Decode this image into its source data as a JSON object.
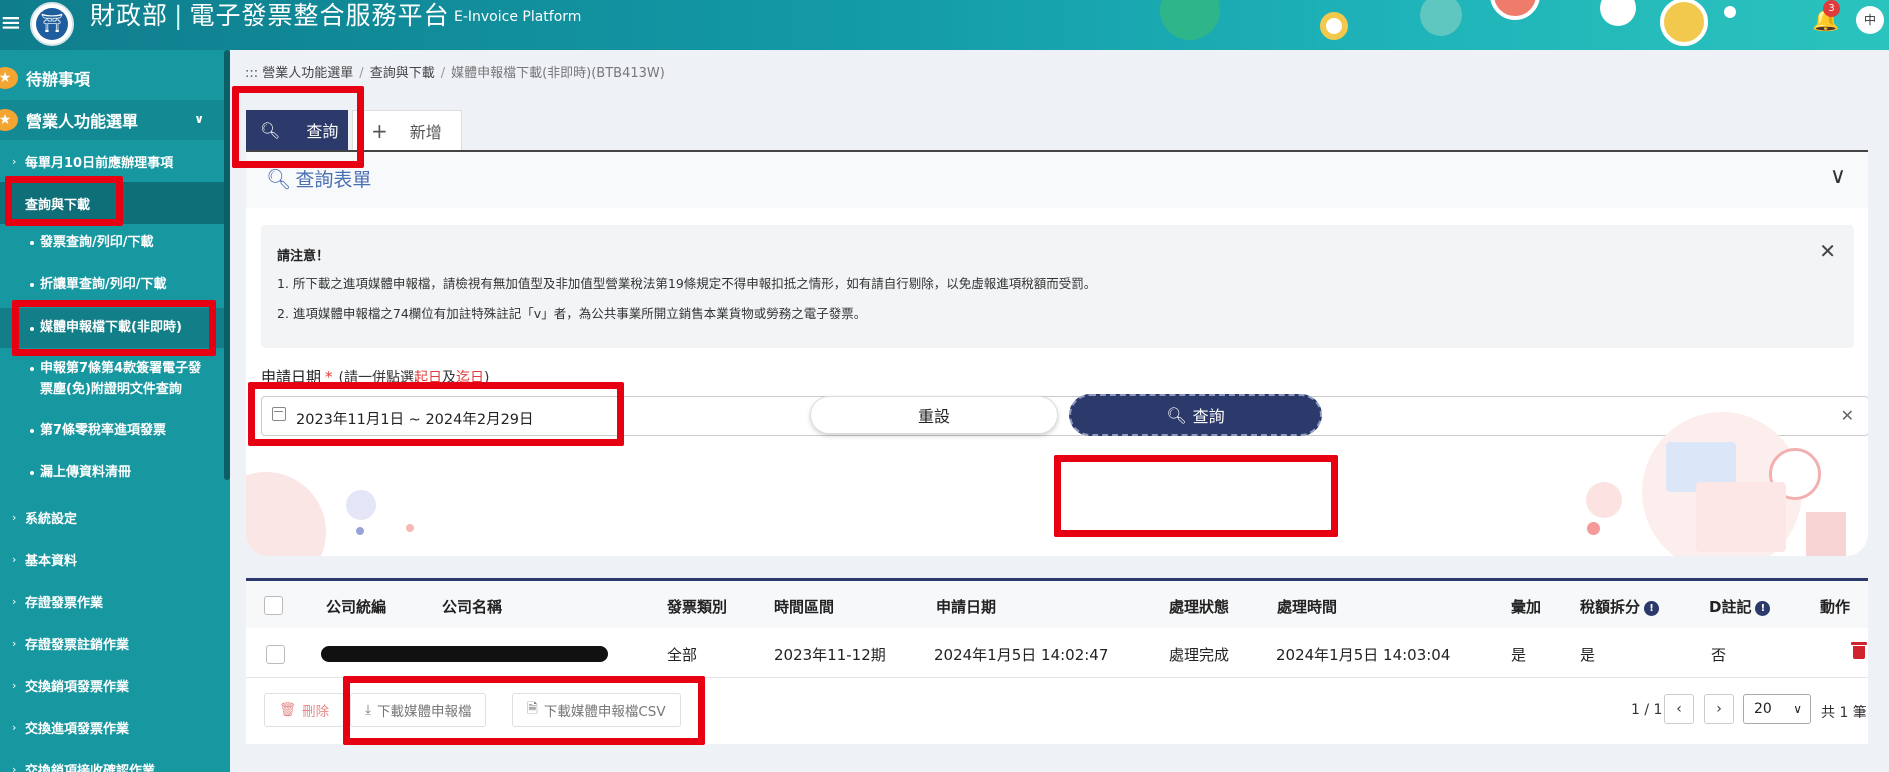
{
  "header": {
    "brand_ministry": "財政部",
    "brand_separator": "|",
    "brand_platform": "電子發票整合服務平台",
    "brand_en": "E-Invoice Platform",
    "logo_icon": "ministry-seal-icon",
    "notification_count": "3",
    "language": "中"
  },
  "sidebar": {
    "todo": "待辦事項",
    "business_menu": "營業人功能選單",
    "items": [
      {
        "label": "每單月10日前應辦理事項"
      },
      {
        "label": "查詢與下載"
      },
      {
        "label": "系統設定"
      },
      {
        "label": "基本資料"
      },
      {
        "label": "存證發票作業"
      },
      {
        "label": "存證發票註銷作業"
      },
      {
        "label": "交換銷項發票作業"
      },
      {
        "label": "交換進項發票作業"
      },
      {
        "label": "交換銷項接收確認作業"
      }
    ],
    "sub_items": [
      {
        "label": "發票查詢/列印/下載"
      },
      {
        "label": "折讓單查詢/列印/下載"
      },
      {
        "label": "媒體申報檔下載(非即時)"
      },
      {
        "label": "申報第7條第4款簽署電子發票塵(免)附證明文件查詢"
      },
      {
        "label": "第7條零稅率進項發票"
      },
      {
        "label": "漏上傳資料清冊"
      }
    ]
  },
  "breadcrumb": {
    "prefix": ":::",
    "items": [
      "營業人功能選單",
      "查詢與下載",
      "媒體申報檔下載(非即時)(BTB413W)"
    ]
  },
  "tabs": {
    "query": "查詢",
    "add": "新增"
  },
  "form": {
    "title": "查詢表單",
    "notice_title": "請注意！",
    "notice_lines": [
      "1. 所下載之進項媒體申報檔，請檢視有無加值型及非加值型營業稅法第19條規定不得申報扣抵之情形，如有請自行剔除，以免虛報進項稅額而受罰。",
      "2. 進項媒體申報檔之74欄位有加註特殊註記「v」者，為公共事業所開立銷售本業貨物或勞務之電子發票。"
    ],
    "date_label": "申請日期",
    "date_required": "*",
    "date_hint_open": "(請一併點選",
    "date_hint_start": "起日",
    "date_hint_and": "及",
    "date_hint_end": "迄日",
    "date_hint_close": ")",
    "date_value": "2023年11月1日 ~ 2024年2月29日",
    "reset_button": "重設",
    "search_button": "查詢"
  },
  "table": {
    "headers": {
      "company_id": "公司統編",
      "company_name": "公司名稱",
      "invoice_type": "發票類別",
      "period": "時間區間",
      "apply_date": "申請日期",
      "status": "處理狀態",
      "process_time": "處理時間",
      "aggregate": "彙加",
      "tax_split": "稅額拆分",
      "d_note": "D註記",
      "action": "動作"
    },
    "rows": [
      {
        "invoice_type": "全部",
        "period": "2023年11-12期",
        "apply_date": "2024年1月5日 14:02:47",
        "status": "處理完成",
        "process_time": "2024年1月5日 14:03:04",
        "aggregate": "是",
        "tax_split": "是",
        "d_note": "否"
      }
    ],
    "footer": {
      "delete_button": "刪除",
      "download_button": "下載媒體申報檔",
      "download_csv_button": "下載媒體申報檔CSV",
      "page_info": "1 / 1",
      "page_size": "20",
      "total": "共 1 筆"
    }
  },
  "colors": {
    "header_gradient_start": "#0f7d8c",
    "sidebar": "#17979f",
    "primary_navy": "#2c3a6b",
    "highlight_red": "#e60012",
    "danger": "#d0232b"
  }
}
